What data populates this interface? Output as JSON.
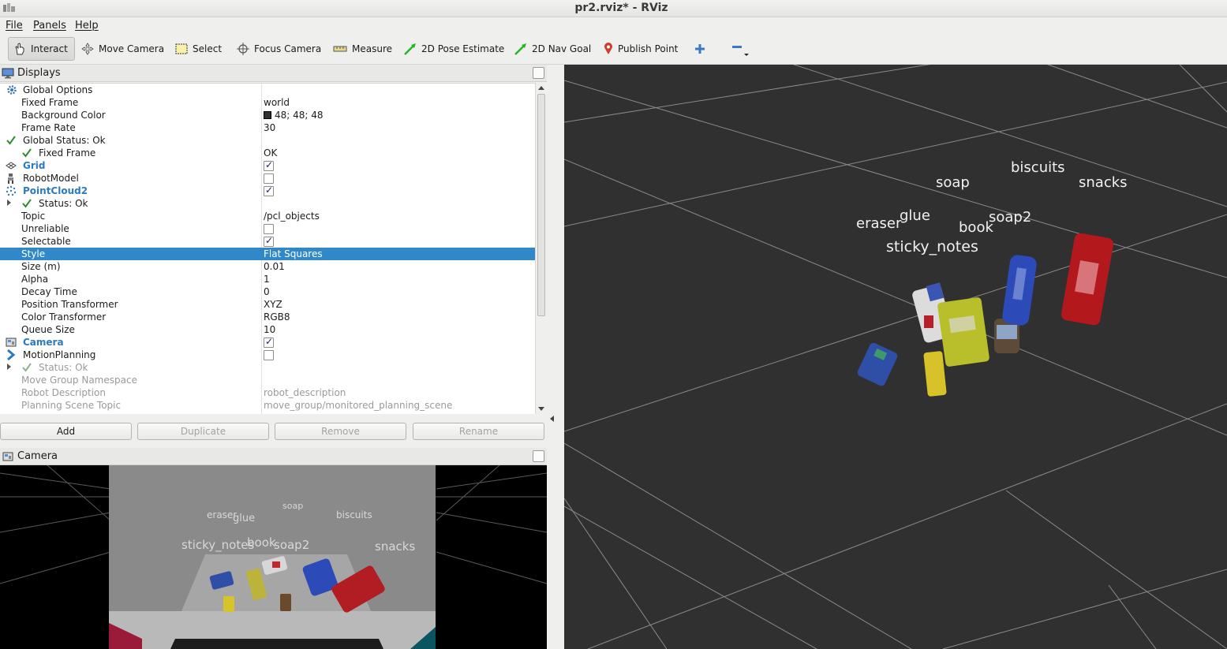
{
  "window": {
    "title": "pr2.rviz* - RViz"
  },
  "menu": {
    "items": [
      "File",
      "Panels",
      "Help"
    ]
  },
  "toolbar": {
    "tools": [
      {
        "label": "Interact",
        "icon": "hand-icon"
      },
      {
        "label": "Move Camera",
        "icon": "move-camera-icon"
      },
      {
        "label": "Select",
        "icon": "select-rect-icon"
      },
      {
        "label": "Focus Camera",
        "icon": "crosshair-icon"
      },
      {
        "label": "Measure",
        "icon": "ruler-icon"
      },
      {
        "label": "2D Pose Estimate",
        "icon": "green-arrow-icon"
      },
      {
        "label": "2D Nav Goal",
        "icon": "green-arrow-icon"
      },
      {
        "label": "Publish Point",
        "icon": "map-pin-icon"
      }
    ]
  },
  "displays_panel": {
    "title": "Displays",
    "rows": {
      "global_options": "Global Options",
      "fixed_frame": {
        "name": "Fixed Frame",
        "value": "world"
      },
      "background_color": {
        "name": "Background Color",
        "value": "48; 48; 48"
      },
      "frame_rate": {
        "name": "Frame Rate",
        "value": "30"
      },
      "global_status": "Global Status: Ok",
      "fixed_frame_status": {
        "name": "Fixed Frame",
        "value": "OK"
      },
      "grid": "Grid",
      "robot_model": "RobotModel",
      "pointcloud2": "PointCloud2",
      "status_ok": "Status: Ok",
      "topic": {
        "name": "Topic",
        "value": "/pcl_objects"
      },
      "unreliable": "Unreliable",
      "selectable": "Selectable",
      "style": {
        "name": "Style",
        "value": "Flat Squares"
      },
      "size": {
        "name": "Size (m)",
        "value": "0.01"
      },
      "alpha": {
        "name": "Alpha",
        "value": "1"
      },
      "decay_time": {
        "name": "Decay Time",
        "value": "0"
      },
      "position_transformer": {
        "name": "Position Transformer",
        "value": "XYZ"
      },
      "color_transformer": {
        "name": "Color Transformer",
        "value": "RGB8"
      },
      "queue_size": {
        "name": "Queue Size",
        "value": "10"
      },
      "camera": "Camera",
      "motion_planning": "MotionPlanning",
      "mp_status": "Status: Ok",
      "move_group_namespace": "Move Group Namespace",
      "robot_description": {
        "name": "Robot Description",
        "value": "robot_description"
      },
      "planning_scene_topic": {
        "name": "Planning Scene Topic",
        "value": "move_group/monitored_planning_scene"
      }
    },
    "checkboxes": {
      "grid": true,
      "robot_model": false,
      "pointcloud2": true,
      "unreliable": false,
      "selectable": true,
      "camera": true,
      "motion_planning": false
    },
    "buttons": {
      "add": "Add",
      "duplicate": "Duplicate",
      "remove": "Remove",
      "rename": "Rename"
    }
  },
  "camera_panel": {
    "title": "Camera",
    "labels": [
      "eraser",
      "glue",
      "soap",
      "biscuits",
      "sticky_notes",
      "book",
      "soap2",
      "snacks"
    ]
  },
  "view3d": {
    "background": "#303030",
    "labels": [
      "soap",
      "biscuits",
      "snacks",
      "eraser",
      "glue",
      "soap2",
      "book",
      "sticky_notes"
    ]
  },
  "colors": {
    "selection": "#3188c9",
    "link_blue": "#2c7bbf",
    "check_green": "#2e8b2e"
  }
}
